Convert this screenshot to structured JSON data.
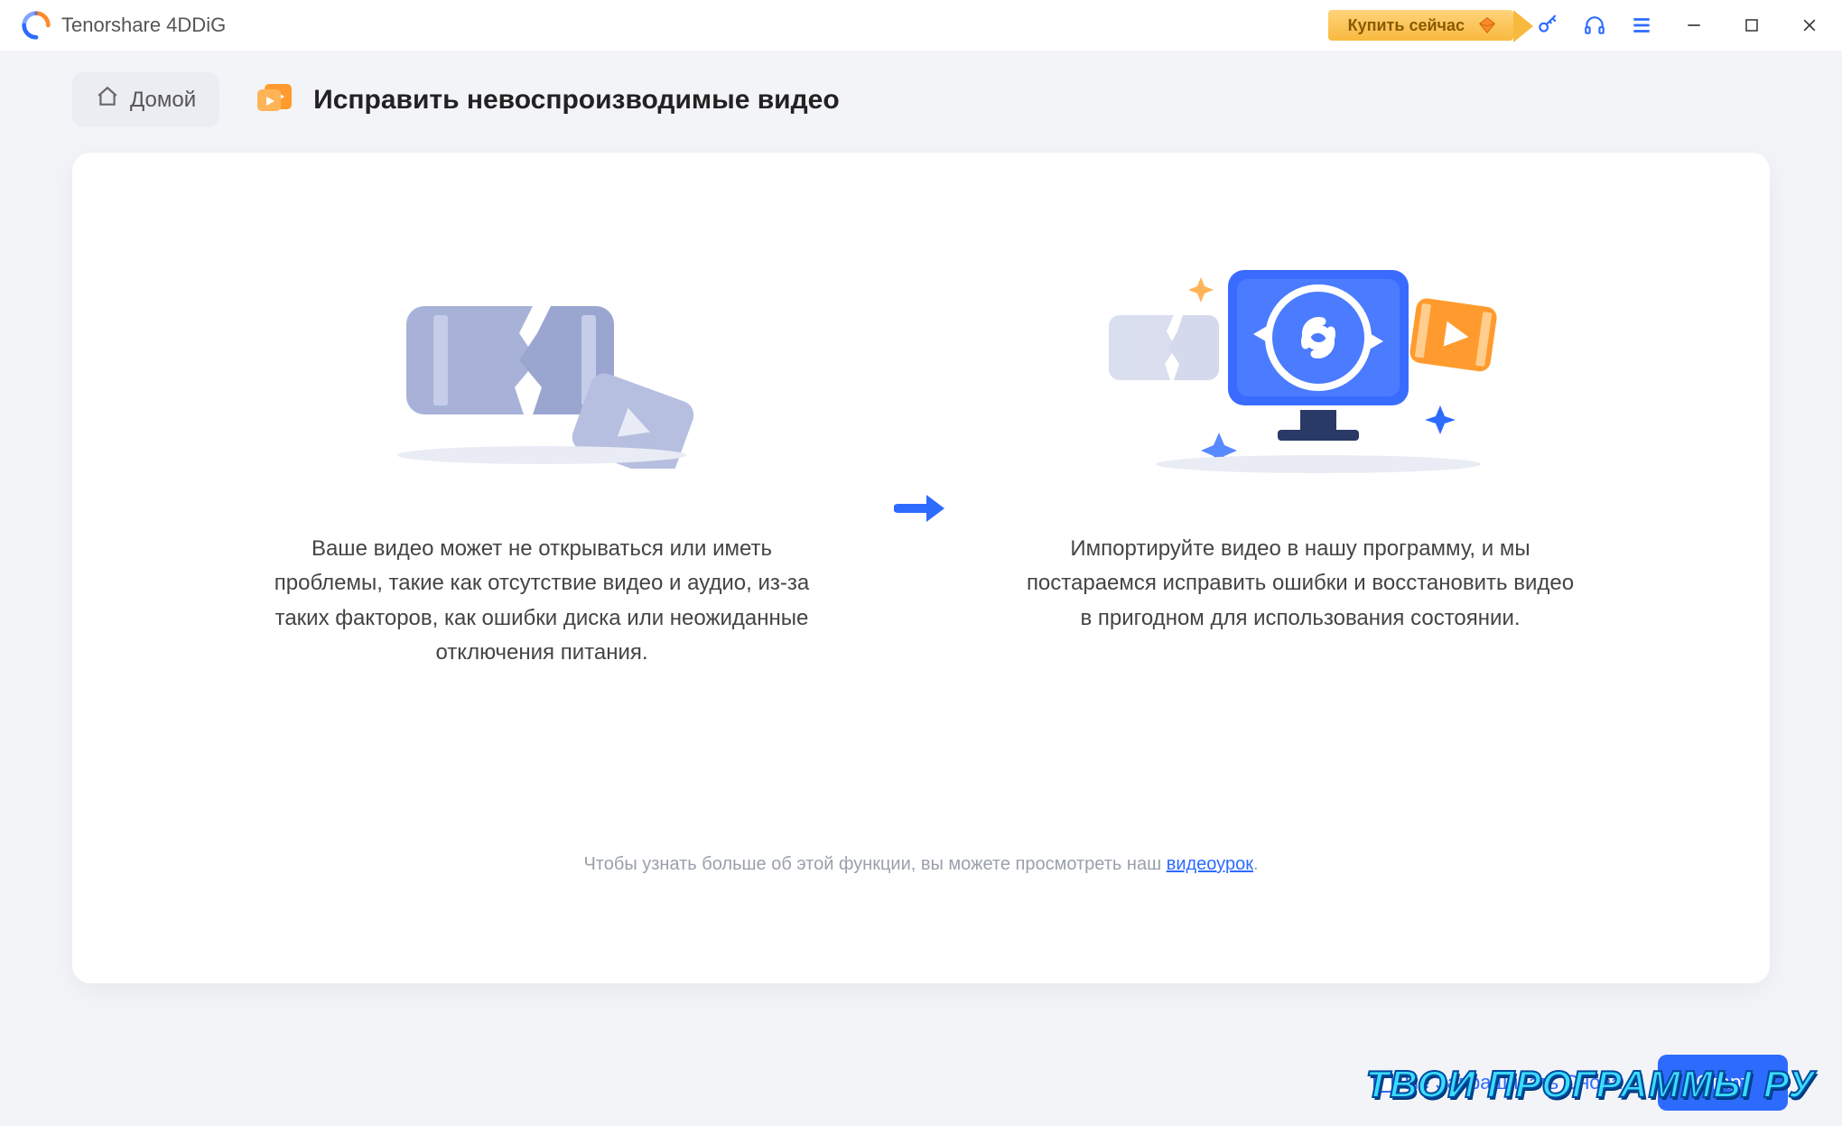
{
  "titlebar": {
    "app_title": "Tenorshare 4DDiG",
    "buy_label": "Купить сейчас"
  },
  "header": {
    "home_label": "Домой",
    "page_title": "Исправить невоспроизводимые видео"
  },
  "content": {
    "left_desc": "Ваше видео может не открываться или иметь проблемы, такие как отсутствие видео и аудио, из-за таких факторов, как ошибки диска или неожиданные отключения питания.",
    "right_desc": "Импортируйте видео в нашу программу, и мы постараемся исправить ошибки и восстановить видео в пригодном для использования состоянии.",
    "hint_prefix": "Чтобы узнать больше об этой функции, вы можете просмотреть наш ",
    "hint_link": "видеоурок",
    "hint_suffix": "."
  },
  "footer": {
    "checkbox_label": "Не Запрашивать Снова",
    "start_label": "Старт"
  },
  "watermark": "ТВОИ ПРОГРАММЫ РУ"
}
